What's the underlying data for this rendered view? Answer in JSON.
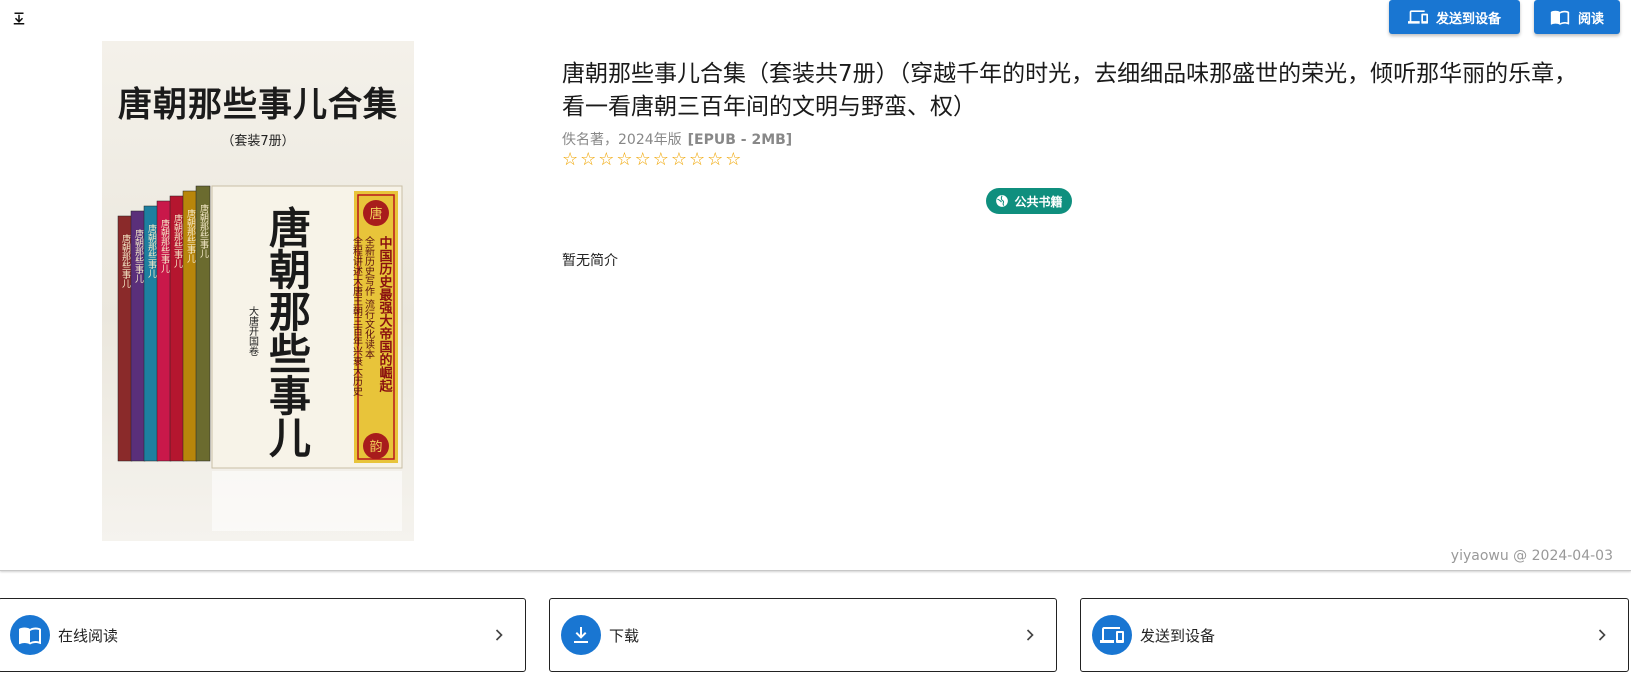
{
  "toolbar": {
    "download_icon": "download-icon",
    "send_label": "发送到设备",
    "read_label": "阅读"
  },
  "cover": {
    "title": "唐朝那些事儿合集",
    "subtitle": "（套装7册）",
    "spine_text": "唐朝那些事儿",
    "main_calligraphy": "唐朝那些事儿",
    "volume_label": "大唐开国卷",
    "side_lines": [
      "中国历史最强大帝国的崛起",
      "全新历史写作 流行文化读本",
      "全程讲述大唐王朝三百年兴衰大历史"
    ],
    "seal_top": "唐",
    "seal_bottom": "韵",
    "spine_colors": [
      "#8a2a2a",
      "#5a2f7a",
      "#1d7fa0",
      "#c9184a",
      "#b5162f",
      "#b8860b",
      "#6b6b2f"
    ]
  },
  "book": {
    "title": "唐朝那些事儿合集（套装共7册）（穿越千年的时光，去细细品味那盛世的荣光，倾听那华丽的乐章，看一看唐朝三百年间的文明与野蛮、权）",
    "meta": "佚名著，2024年版",
    "format": "[EPUB - 2MB]",
    "rating": 0,
    "rating_max": 10,
    "badge": "公共书籍",
    "description": "暂无简介",
    "uploader_note": "yiyaowu @ 2024-04-03"
  },
  "actions": [
    {
      "label": "在线阅读",
      "icon": "book-open-icon"
    },
    {
      "label": "下载",
      "icon": "download-icon"
    },
    {
      "label": "发送到设备",
      "icon": "devices-icon"
    }
  ],
  "colors": {
    "primary": "#1976d2",
    "badge": "#0f8f7e",
    "star": "#f0a500"
  }
}
